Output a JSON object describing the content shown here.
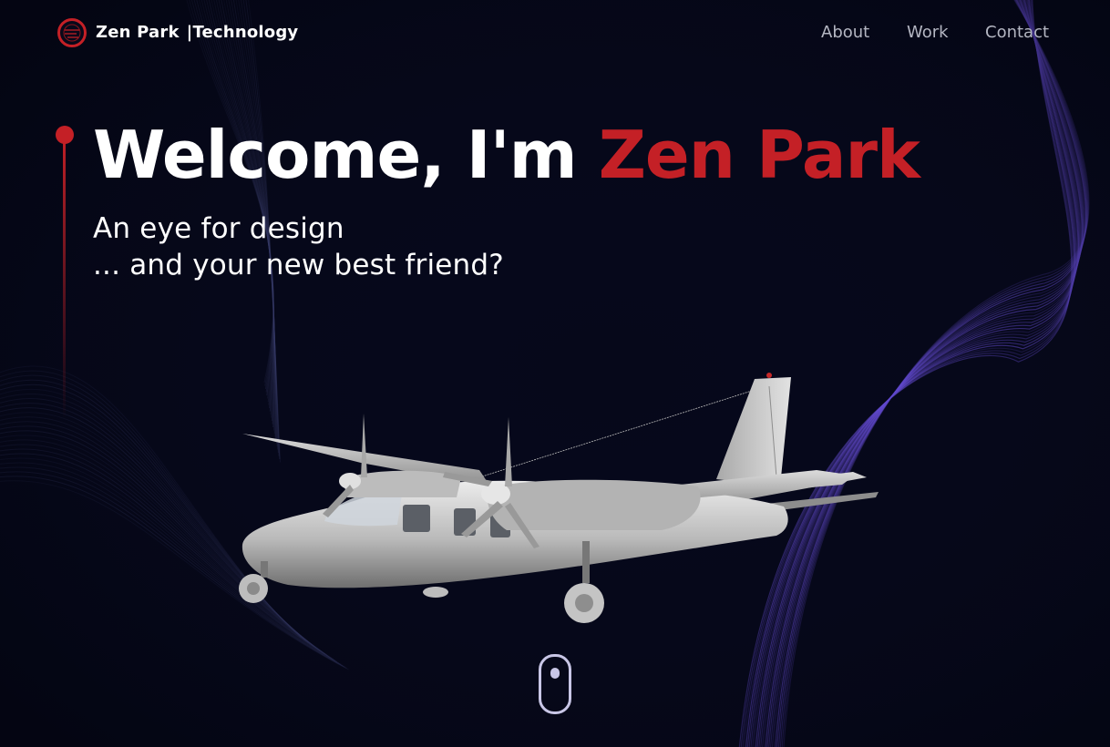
{
  "brand": {
    "logo_icon": "zen-park-logo-icon",
    "name": "Zen Park",
    "separator": "|",
    "division": "Technology"
  },
  "nav": {
    "items": [
      {
        "label": "About"
      },
      {
        "label": "Work"
      },
      {
        "label": "Contact"
      }
    ]
  },
  "hero": {
    "greeting": "Welcome, I'm",
    "name": "Zen Park",
    "subtitle_line1": "An eye for design",
    "subtitle_line2": "... and your new best friend?"
  },
  "scroll_indicator": {
    "icon": "mouse-scroll-icon"
  },
  "illustration": {
    "icon": "twin-prop-airplane-icon"
  },
  "colors": {
    "background": "#06081a",
    "accent": "#c42026",
    "text": "#ffffff",
    "nav_text": "#b4b6c2",
    "wave_lines": "#7b5cff"
  }
}
